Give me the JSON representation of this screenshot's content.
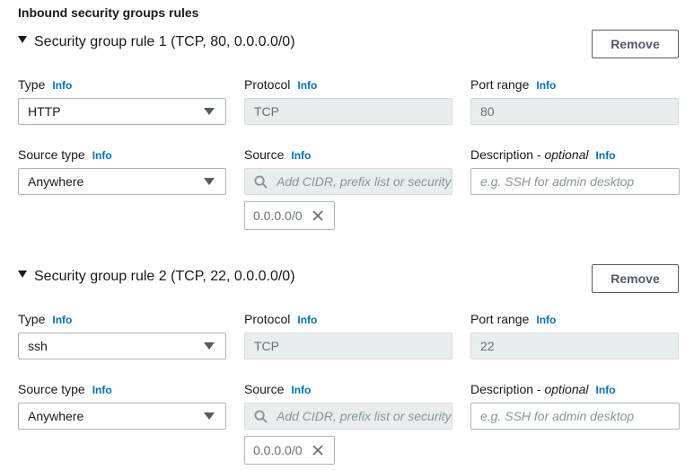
{
  "section": {
    "title": "Inbound security groups rules"
  },
  "labels": {
    "type": "Type",
    "protocol": "Protocol",
    "port_range": "Port range",
    "source_type": "Source type",
    "source": "Source",
    "description": "Description -",
    "optional": "optional",
    "info": "Info",
    "remove": "Remove"
  },
  "rules": [
    {
      "title": "Security group rule 1 (TCP, 80, 0.0.0.0/0)",
      "type_value": "HTTP",
      "protocol_value": "TCP",
      "port_range_value": "80",
      "source_type_value": "Anywhere",
      "source_placeholder": "Add CIDR, prefix list or security group",
      "source_token": "0.0.0.0/0",
      "description_placeholder": "e.g. SSH for admin desktop",
      "description_value": ""
    },
    {
      "title": "Security group rule 2 (TCP, 22, 0.0.0.0/0)",
      "type_value": "ssh",
      "protocol_value": "TCP",
      "port_range_value": "22",
      "source_type_value": "Anywhere",
      "source_placeholder": "Add CIDR, prefix list or security group",
      "source_token": "0.0.0.0/0",
      "description_placeholder": "e.g. SSH for admin desktop",
      "description_value": ""
    }
  ],
  "icons": {
    "expand": "caret-down-icon",
    "dropdown": "chevron-down-icon",
    "search": "search-icon",
    "remove_token": "close-icon"
  },
  "colors": {
    "link": "#0073bb",
    "text": "#16191f",
    "muted_text": "#687078",
    "disabled_bg": "#eaeded",
    "border": "#aab7b8"
  }
}
